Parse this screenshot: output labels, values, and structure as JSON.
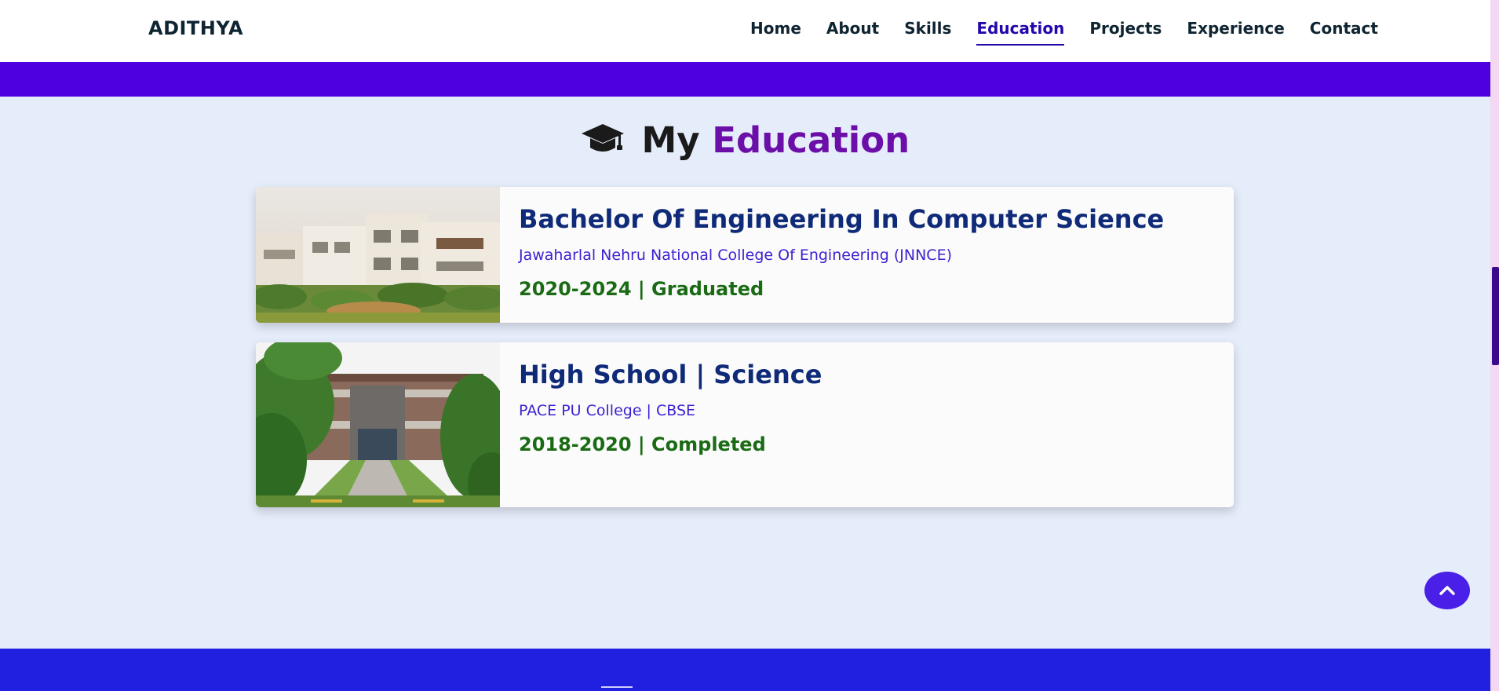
{
  "header": {
    "logo": "ADITHYA",
    "nav": [
      {
        "label": "Home"
      },
      {
        "label": "About"
      },
      {
        "label": "Skills"
      },
      {
        "label": "Education",
        "active": true
      },
      {
        "label": "Projects"
      },
      {
        "label": "Experience"
      },
      {
        "label": "Contact"
      }
    ]
  },
  "section": {
    "icon": "graduation-cap-icon",
    "title_prefix": "My",
    "title_accent": "Education"
  },
  "education": [
    {
      "degree": "Bachelor Of Engineering In Computer Science",
      "school": "Jawaharlal Nehru National College Of Engineering (JNNCE)",
      "date": "2020-2024 | Graduated"
    },
    {
      "degree": "High School | Science",
      "school": "PACE PU College | CBSE",
      "date": "2018-2020 | Completed"
    }
  ],
  "scroll_top": {
    "icon": "chevron-up-icon"
  },
  "colors": {
    "accent": "#4f00e0",
    "title_accent": "#6c0ea8",
    "degree": "#0f2a78",
    "school": "#3b22d1",
    "date": "#1a6b14",
    "background": "#e5ecfa",
    "footer": "#2220e0"
  }
}
